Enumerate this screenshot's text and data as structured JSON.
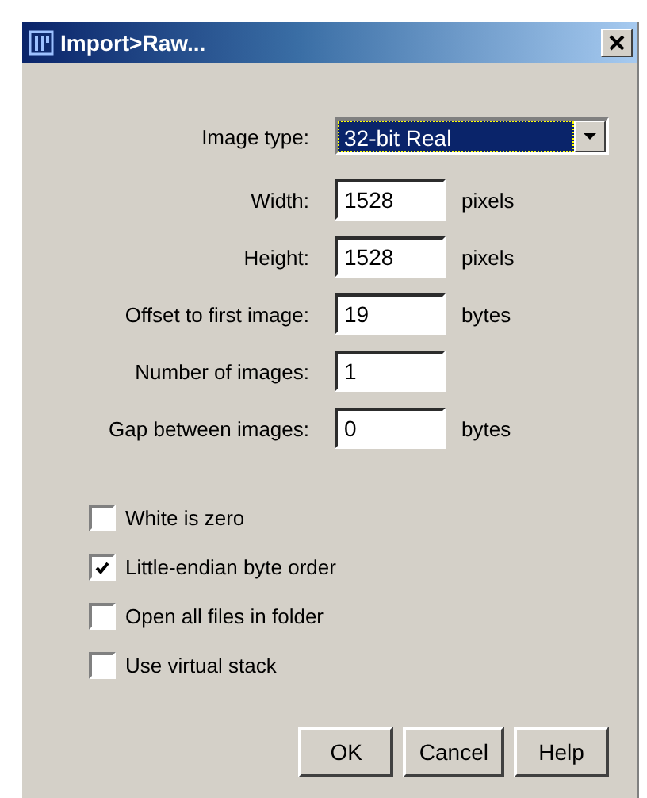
{
  "window": {
    "title": "Import>Raw..."
  },
  "image_type": {
    "label": "Image type:",
    "value": "32-bit Real"
  },
  "fields": [
    {
      "label": "Width:",
      "value": "1528",
      "unit": "pixels"
    },
    {
      "label": "Height:",
      "value": "1528",
      "unit": "pixels"
    },
    {
      "label": "Offset to first image:",
      "value": "19",
      "unit": "bytes"
    },
    {
      "label": "Number of images:",
      "value": "1"
    },
    {
      "label": "Gap between images:",
      "value": "0",
      "unit": "bytes"
    }
  ],
  "options": [
    {
      "label": "White is zero",
      "checked": false
    },
    {
      "label": "Little-endian byte order",
      "checked": true
    },
    {
      "label": "Open all files in folder",
      "checked": false
    },
    {
      "label": "Use virtual stack",
      "checked": false
    }
  ],
  "buttons": [
    "OK",
    "Cancel",
    "Help"
  ]
}
